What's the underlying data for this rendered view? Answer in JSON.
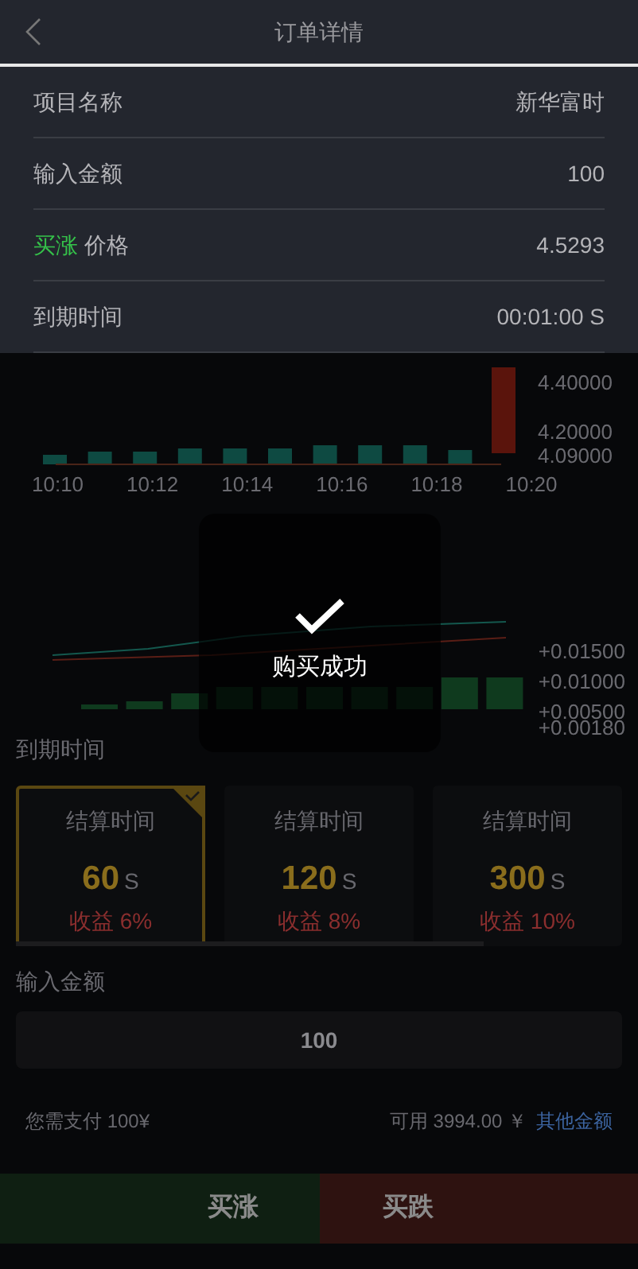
{
  "header": {
    "title": "订单详情"
  },
  "details": [
    {
      "kind": "plain",
      "label": "项目名称",
      "value": "新华富时"
    },
    {
      "kind": "plain",
      "label": "输入金额",
      "value": "100"
    },
    {
      "kind": "direction",
      "direction": "买涨",
      "label": "价格",
      "value": "4.5293"
    },
    {
      "kind": "plain",
      "label": "到期时间",
      "value": "00:01:00 S"
    }
  ],
  "price_chart": {
    "y_labels": [
      "4.40000",
      "4.20000",
      "4.09000"
    ],
    "x_labels": [
      "10:10",
      "10:12",
      "10:14",
      "10:16",
      "10:18",
      "10:20"
    ]
  },
  "indicator_chart": {
    "y_labels": [
      "+0.01500",
      "+0.01000",
      "+0.00500",
      "+0.00180"
    ]
  },
  "toast": {
    "message": "购买成功"
  },
  "expiry": {
    "title": "到期时间",
    "options": [
      {
        "caption": "结算时间",
        "seconds": "60",
        "unit": "S",
        "profit": "收益 6%",
        "selected": true
      },
      {
        "caption": "结算时间",
        "seconds": "120",
        "unit": "S",
        "profit": "收益 8%",
        "selected": false
      },
      {
        "caption": "结算时间",
        "seconds": "300",
        "unit": "S",
        "profit": "收益 10%",
        "selected": false
      }
    ]
  },
  "amount": {
    "title": "输入金额",
    "value": "100"
  },
  "payment": {
    "due": "您需支付 100¥",
    "available": "可用 3994.00 ￥",
    "link": "其他金额"
  },
  "actions": [
    {
      "kind": "up",
      "label": "买涨"
    },
    {
      "kind": "down",
      "label": "买跌"
    }
  ]
}
